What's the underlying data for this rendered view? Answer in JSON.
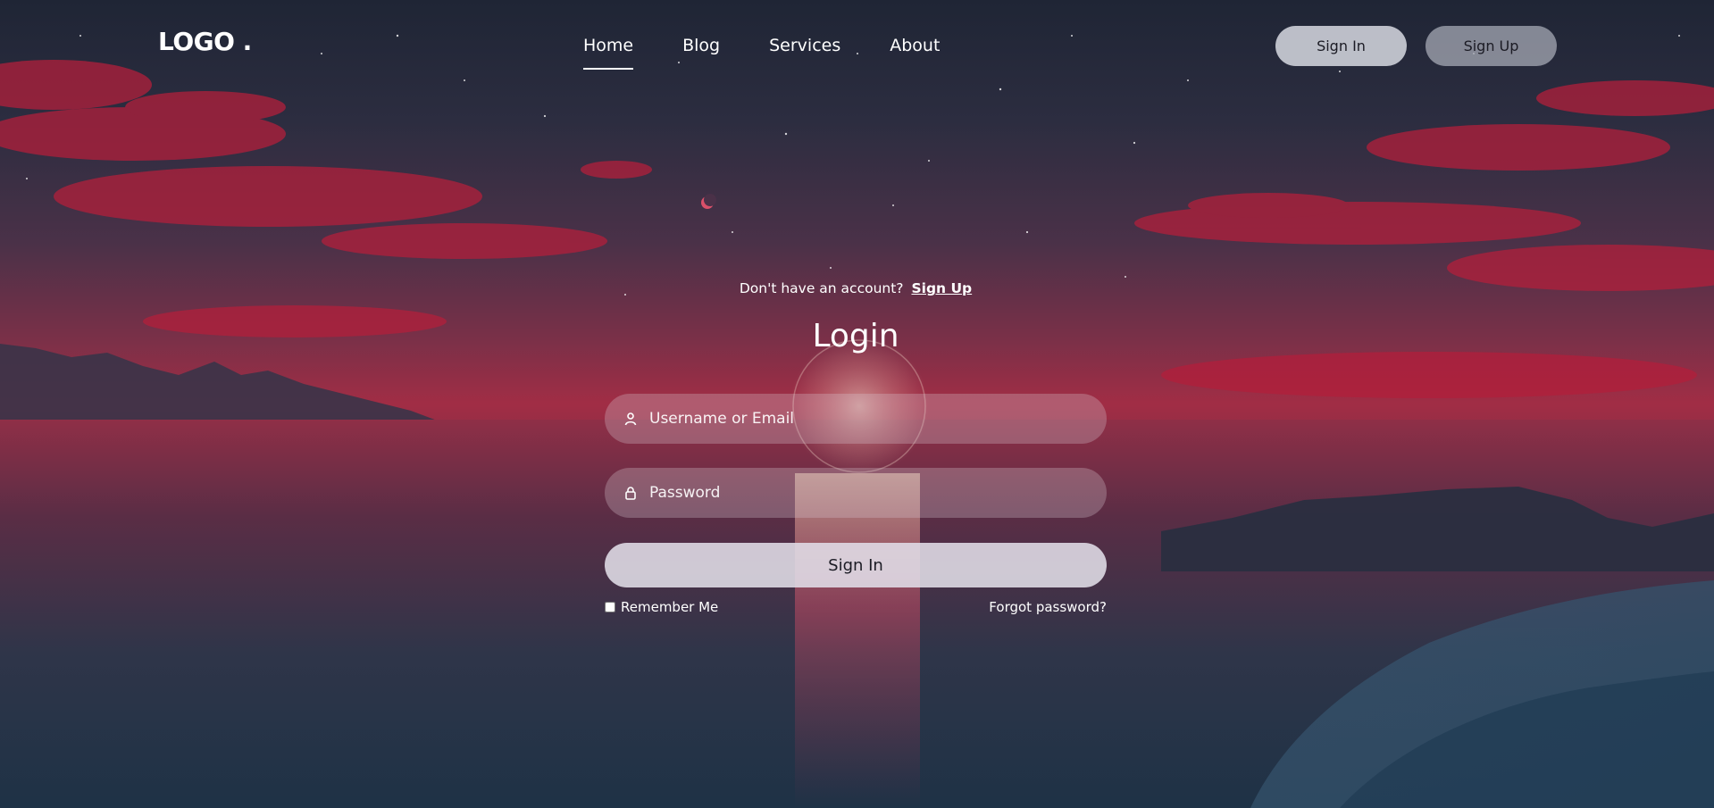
{
  "brand": {
    "logo": "LOGO ."
  },
  "nav": {
    "items": [
      {
        "label": "Home",
        "active": true
      },
      {
        "label": "Blog",
        "active": false
      },
      {
        "label": "Services",
        "active": false
      },
      {
        "label": "About",
        "active": false
      }
    ]
  },
  "header_actions": {
    "sign_in": "Sign In",
    "sign_up": "Sign Up"
  },
  "login": {
    "account_prompt": "Don't have an account?",
    "account_link": "Sign Up",
    "title": "Login",
    "username_placeholder": "Username or Email",
    "password_placeholder": "Password",
    "submit": "Sign In",
    "remember_me": "Remember Me",
    "forgot_password": "Forgot password?"
  },
  "icons": {
    "username": "user-icon",
    "password": "lock-icon"
  },
  "colors": {
    "sky_top": "#1f2535",
    "horizon": "#a12d45",
    "sea": "#24364a",
    "clouds": "#b0203a"
  }
}
